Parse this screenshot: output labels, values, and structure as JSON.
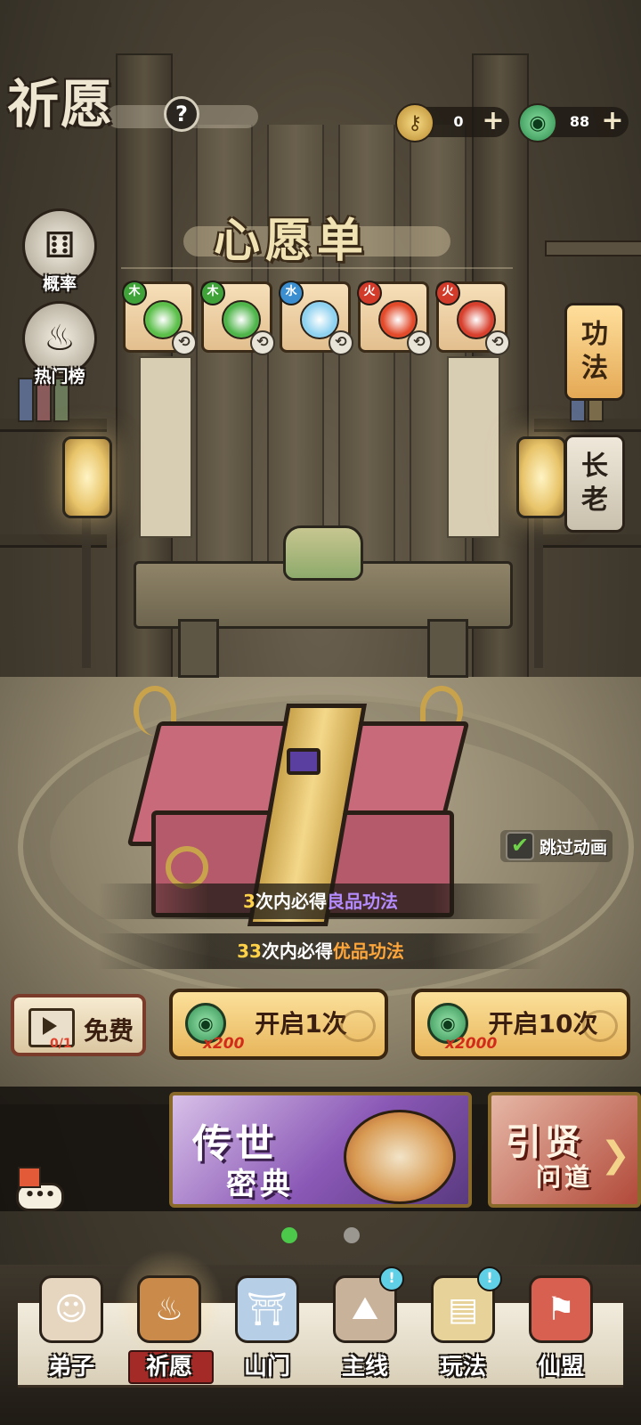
{
  "header": {
    "title": "祈愿",
    "help_label": "?"
  },
  "resources": {
    "keys": {
      "icon": "key-icon",
      "value": "0",
      "add_label": "+"
    },
    "jade": {
      "icon": "jade-coin-icon",
      "value": "88",
      "add_label": "+"
    }
  },
  "side_menu": {
    "probability": {
      "label": "概率",
      "icon": "dice-icon"
    },
    "ranking": {
      "label": "热门榜",
      "icon": "flame-scroll-icon"
    }
  },
  "wishlist": {
    "title": "心愿单",
    "cards": [
      {
        "element": "木",
        "element_color": "#3fa33a",
        "orb_color": "#5bbf4a"
      },
      {
        "element": "木",
        "element_color": "#3fa33a",
        "orb_color": "#4fb54a"
      },
      {
        "element": "水",
        "element_color": "#3b8fd0",
        "orb_color": "#8fd2f0"
      },
      {
        "element": "火",
        "element_color": "#d23a2a",
        "orb_color": "#e24a2a"
      },
      {
        "element": "火",
        "element_color": "#d23a2a",
        "orb_color": "#d8402e"
      }
    ]
  },
  "right_tabs": {
    "gongfa": {
      "line1": "功",
      "line2": "法"
    },
    "elder": {
      "line1": "长",
      "line2": "老"
    }
  },
  "skip_animation": {
    "label": "跳过动画",
    "checked": true
  },
  "guarantees": [
    {
      "count": "3",
      "text": "次内必得",
      "quality": "良品功法",
      "quality_color": "#b58cff"
    },
    {
      "count": "33",
      "text": "次内必得",
      "quality": "优品功法",
      "quality_color": "#ffa63a"
    }
  ],
  "actions": {
    "free": {
      "label": "免费",
      "counter": "0/1"
    },
    "open_once": {
      "label": "开启1次",
      "cost": "x200"
    },
    "open_ten": {
      "label": "开启10次",
      "cost": "x2000"
    }
  },
  "promos": [
    {
      "line1": "传世",
      "line2": "密典"
    },
    {
      "line1": "引贤",
      "line2": "问道"
    }
  ],
  "carousel": {
    "current": 1,
    "total": 2
  },
  "nav": [
    {
      "label": "弟子",
      "icon": "disciple-icon",
      "active": false,
      "alert": false
    },
    {
      "label": "祈愿",
      "icon": "wish-scroll-icon",
      "active": true,
      "alert": false
    },
    {
      "label": "山门",
      "icon": "sect-gate-icon",
      "active": false,
      "alert": false
    },
    {
      "label": "主线",
      "icon": "mountain-sword-icon",
      "active": false,
      "alert": true
    },
    {
      "label": "玩法",
      "icon": "scroll-board-icon",
      "active": false,
      "alert": true
    },
    {
      "label": "仙盟",
      "icon": "alliance-banner-icon",
      "active": false,
      "alert": false
    }
  ],
  "colors": {
    "accent_gold": "#e8b65c",
    "cost_red": "#d22b1a",
    "good_quality": "#b58cff",
    "fine_quality": "#ffa63a",
    "check_green": "#6fd34a"
  }
}
